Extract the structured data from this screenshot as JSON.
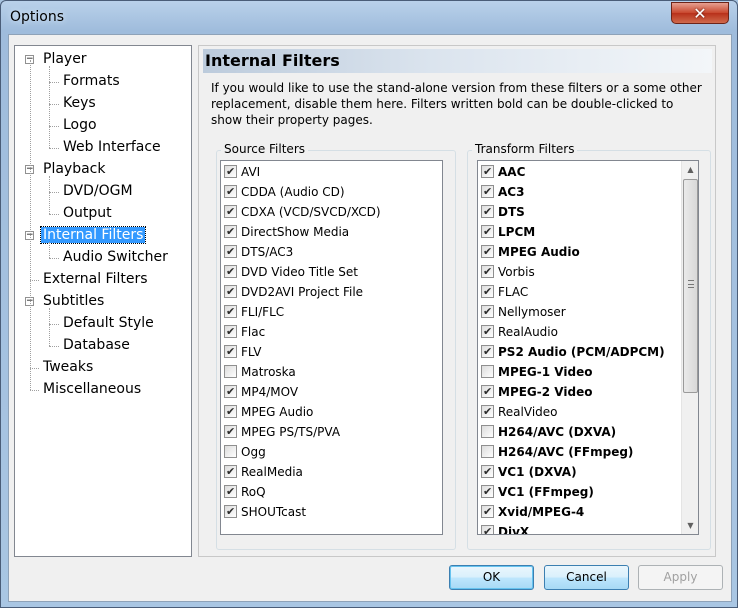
{
  "window": {
    "title": "Options",
    "close_glyph": "✕"
  },
  "tree": {
    "items": [
      {
        "label": "Player",
        "level": 0,
        "expander": "−"
      },
      {
        "label": "Formats",
        "level": 1
      },
      {
        "label": "Keys",
        "level": 1
      },
      {
        "label": "Logo",
        "level": 1
      },
      {
        "label": "Web Interface",
        "level": 1
      },
      {
        "label": "Playback",
        "level": 0,
        "expander": "−"
      },
      {
        "label": "DVD/OGM",
        "level": 1
      },
      {
        "label": "Output",
        "level": 1
      },
      {
        "label": "Internal Filters",
        "level": 0,
        "expander": "−",
        "selected": true
      },
      {
        "label": "Audio Switcher",
        "level": 1
      },
      {
        "label": "External Filters",
        "level": 0
      },
      {
        "label": "Subtitles",
        "level": 0,
        "expander": "−"
      },
      {
        "label": "Default Style",
        "level": 1
      },
      {
        "label": "Database",
        "level": 1
      },
      {
        "label": "Tweaks",
        "level": 0
      },
      {
        "label": "Miscellaneous",
        "level": 0
      }
    ]
  },
  "panel": {
    "title": "Internal Filters",
    "description": "If you would like to use the stand-alone version from these filters or a some other replacement, disable them here. Filters written bold can be double-clicked to show their property pages."
  },
  "source_filters": {
    "title": "Source Filters",
    "items": [
      {
        "label": "AVI",
        "checked": true
      },
      {
        "label": "CDDA (Audio CD)",
        "checked": true
      },
      {
        "label": "CDXA (VCD/SVCD/XCD)",
        "checked": true
      },
      {
        "label": "DirectShow Media",
        "checked": true
      },
      {
        "label": "DTS/AC3",
        "checked": true
      },
      {
        "label": "DVD Video Title Set",
        "checked": true
      },
      {
        "label": "DVD2AVI Project File",
        "checked": true
      },
      {
        "label": "FLI/FLC",
        "checked": true
      },
      {
        "label": "Flac",
        "checked": true
      },
      {
        "label": "FLV",
        "checked": true
      },
      {
        "label": "Matroska",
        "checked": false
      },
      {
        "label": "MP4/MOV",
        "checked": true
      },
      {
        "label": "MPEG Audio",
        "checked": true
      },
      {
        "label": "MPEG PS/TS/PVA",
        "checked": true
      },
      {
        "label": "Ogg",
        "checked": false
      },
      {
        "label": "RealMedia",
        "checked": true
      },
      {
        "label": "RoQ",
        "checked": true
      },
      {
        "label": "SHOUTcast",
        "checked": true
      }
    ]
  },
  "transform_filters": {
    "title": "Transform Filters",
    "items": [
      {
        "label": "AAC",
        "checked": true,
        "bold": true
      },
      {
        "label": "AC3",
        "checked": true,
        "bold": true
      },
      {
        "label": "DTS",
        "checked": true,
        "bold": true
      },
      {
        "label": "LPCM",
        "checked": true,
        "bold": true
      },
      {
        "label": "MPEG Audio",
        "checked": true,
        "bold": true
      },
      {
        "label": "Vorbis",
        "checked": true,
        "bold": false
      },
      {
        "label": "FLAC",
        "checked": true,
        "bold": false
      },
      {
        "label": "Nellymoser",
        "checked": true,
        "bold": false
      },
      {
        "label": "RealAudio",
        "checked": true,
        "bold": false
      },
      {
        "label": "PS2 Audio (PCM/ADPCM)",
        "checked": true,
        "bold": true
      },
      {
        "label": "MPEG-1 Video",
        "checked": false,
        "bold": true
      },
      {
        "label": "MPEG-2 Video",
        "checked": true,
        "bold": true
      },
      {
        "label": "RealVideo",
        "checked": true,
        "bold": false
      },
      {
        "label": "H264/AVC (DXVA)",
        "checked": false,
        "bold": true
      },
      {
        "label": "H264/AVC (FFmpeg)",
        "checked": false,
        "bold": true
      },
      {
        "label": "VC1 (DXVA)",
        "checked": true,
        "bold": true
      },
      {
        "label": "VC1 (FFmpeg)",
        "checked": true,
        "bold": true
      },
      {
        "label": "Xvid/MPEG-4",
        "checked": true,
        "bold": true
      },
      {
        "label": "DivX",
        "checked": true,
        "bold": true
      }
    ],
    "scroll_up_glyph": "▲",
    "scroll_down_glyph": "▼"
  },
  "buttons": {
    "ok": "OK",
    "cancel": "Cancel",
    "apply": "Apply"
  }
}
